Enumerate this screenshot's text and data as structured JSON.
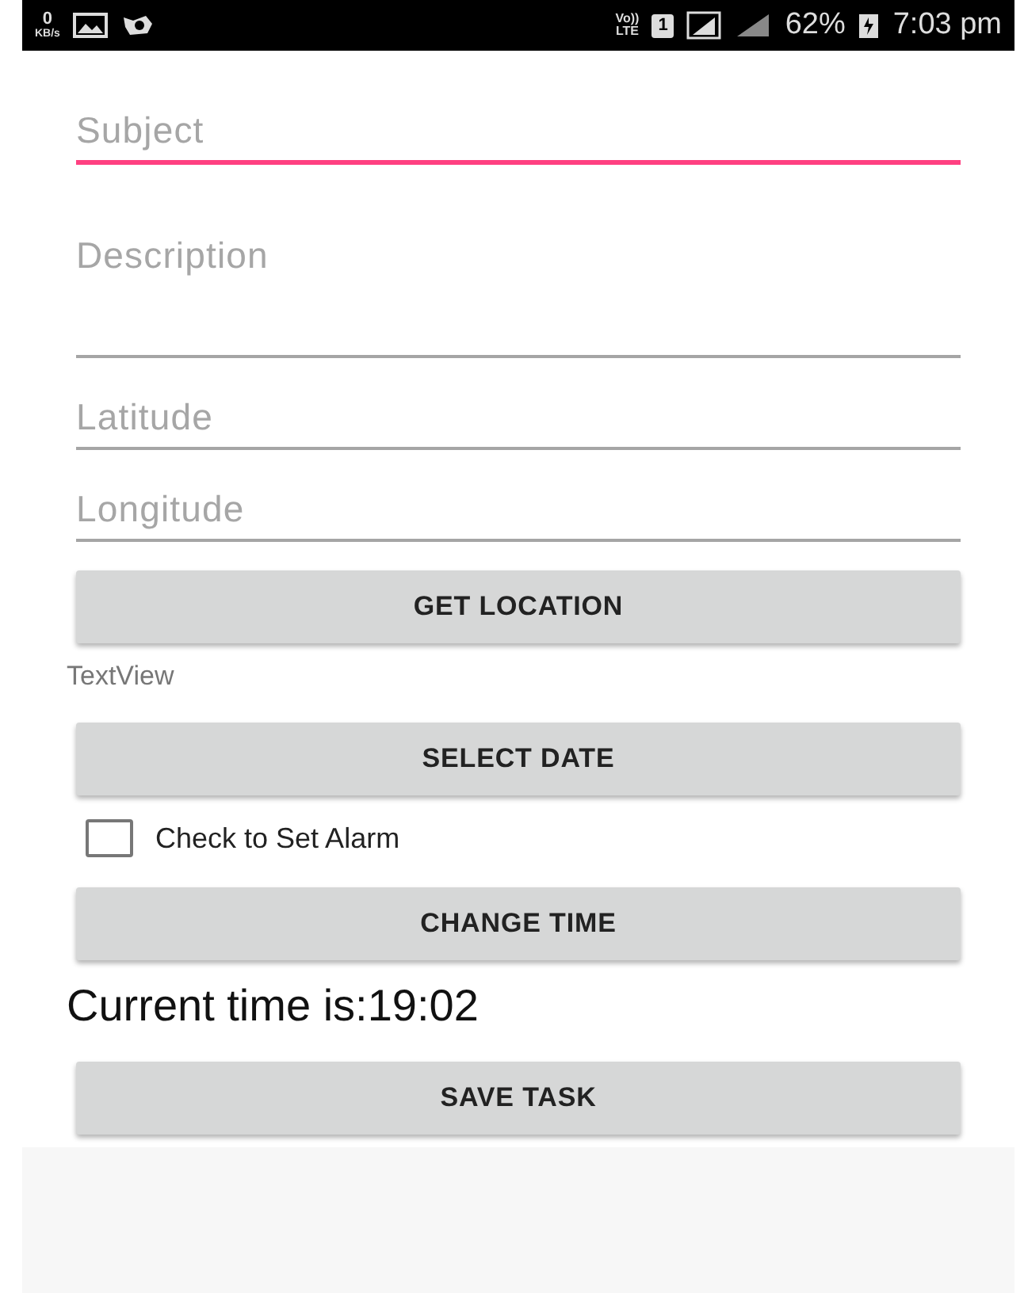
{
  "status_bar": {
    "speed_value": "0",
    "speed_unit": "KB/s",
    "volte_top": "Vo))",
    "volte_bottom": "LTE",
    "sim": "1",
    "battery": "62%",
    "time": "7:03 pm"
  },
  "form": [
    {
      "kind": "field",
      "placeholder": "Subject",
      "focused": true
    },
    {
      "kind": "multiline_field",
      "placeholder": "Description",
      "focused": false
    },
    {
      "kind": "field",
      "placeholder": "Latitude",
      "focused": false
    },
    {
      "kind": "field",
      "placeholder": "Longitude",
      "focused": false
    },
    {
      "kind": "button",
      "label": "GET LOCATION"
    },
    {
      "kind": "label",
      "text": "TextView"
    },
    {
      "kind": "button",
      "label": "SELECT DATE"
    },
    {
      "kind": "checkbox",
      "label": "Check to Set Alarm",
      "checked": false
    },
    {
      "kind": "button",
      "label": "CHANGE TIME"
    },
    {
      "kind": "heading",
      "text": "Current time is:19:02"
    },
    {
      "kind": "button",
      "label": "SAVE TASK"
    }
  ]
}
